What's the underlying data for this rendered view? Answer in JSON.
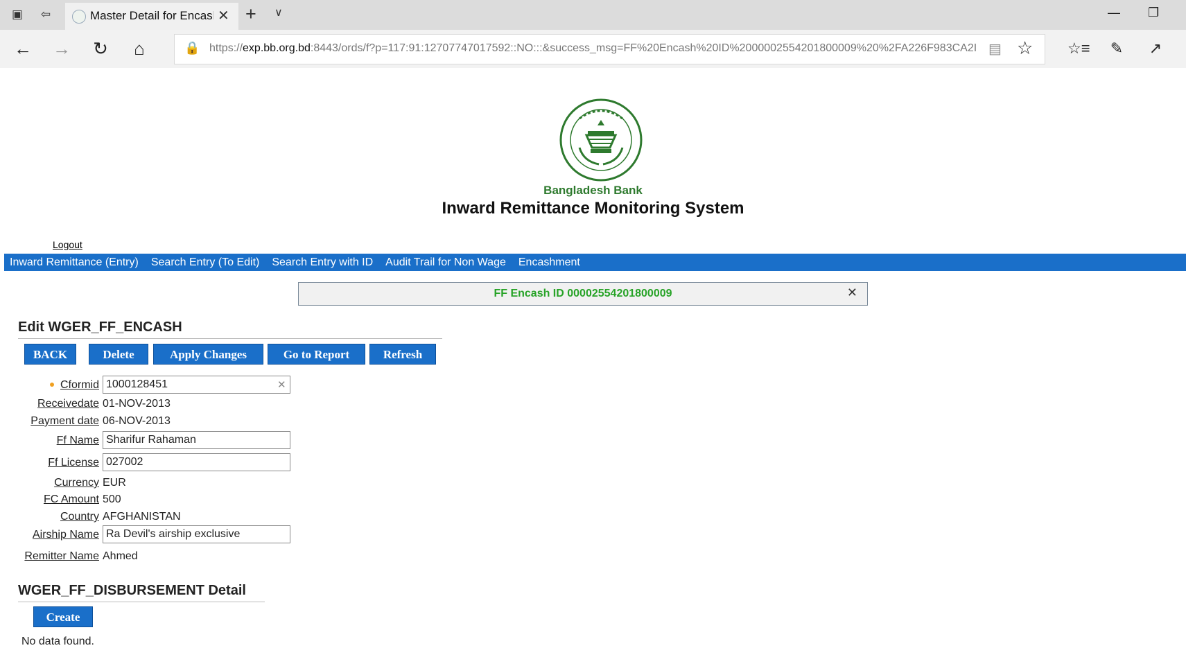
{
  "browser": {
    "tab_title": "Master Detail for Encash",
    "url_prefix": "https://",
    "url_host": "exp.bb.org.bd",
    "url_rest": ":8443/ords/f?p=117:91:12707747017592::NO:::&success_msg=FF%20Encash%20ID%2000002554201800009%20%2FA226F983CA2I"
  },
  "header": {
    "bank_name": "Bangladesh Bank",
    "system_title": "Inward Remittance Monitoring System",
    "logout_label": "Logout"
  },
  "menu": {
    "items": [
      "Inward Remittance (Entry)",
      "Search Entry (To Edit)",
      "Search Entry with ID",
      "Audit Trail for Non Wage",
      "Encashment"
    ]
  },
  "message": {
    "text": "FF Encash ID 00002554201800009"
  },
  "edit_section": {
    "title": "Edit WGER_FF_ENCASH",
    "buttons": {
      "back": "BACK",
      "delete": "Delete",
      "apply": "Apply Changes",
      "report": "Go to Report",
      "refresh": "Refresh"
    }
  },
  "form": {
    "cformid": {
      "label": "Cformid",
      "value": "1000128451"
    },
    "receivedate": {
      "label": "Receivedate",
      "value": "01-NOV-2013"
    },
    "payment_date": {
      "label": "Payment date",
      "value": "06-NOV-2013"
    },
    "ff_name": {
      "label": "Ff Name",
      "value": "Sharifur Rahaman"
    },
    "ff_license": {
      "label": "Ff License",
      "value": "027002"
    },
    "currency": {
      "label": "Currency",
      "value": "EUR"
    },
    "fc_amount": {
      "label": "FC Amount",
      "value": "500"
    },
    "country": {
      "label": "Country",
      "value": "AFGHANISTAN"
    },
    "airship_name": {
      "label": "Airship Name",
      "value": "Ra Devil's airship exclusive"
    },
    "remitter_name": {
      "label": "Remitter Name",
      "value": "Ahmed"
    }
  },
  "detail_section": {
    "title": "WGER_FF_DISBURSEMENT Detail",
    "create_label": "Create",
    "empty_text": "No data found."
  },
  "colors": {
    "menu_blue": "#1a6fc9",
    "success_green": "#27a327",
    "bank_green": "#2e7a2e"
  }
}
